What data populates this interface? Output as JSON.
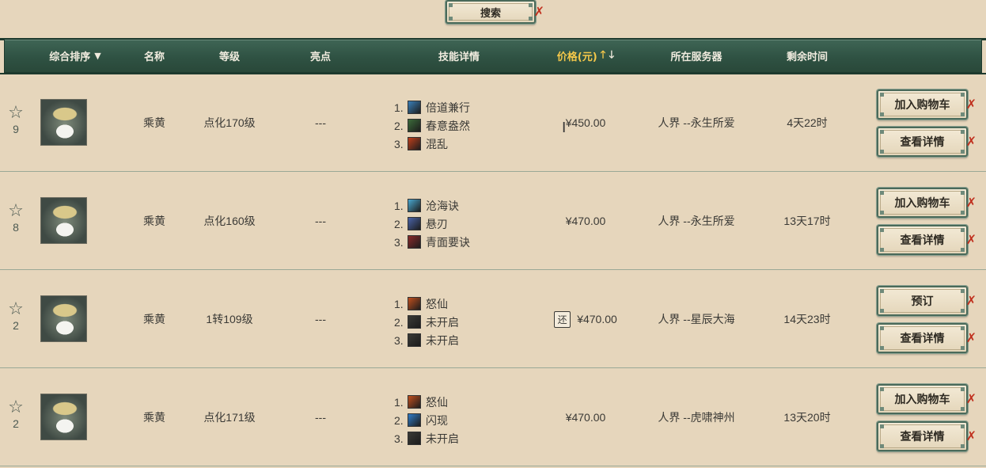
{
  "search": {
    "label": "搜索"
  },
  "header": {
    "sort": "综合排序",
    "name": "名称",
    "level": "等级",
    "highlight": "亮点",
    "skills": "技能详情",
    "price": "价格(元)",
    "server": "所在服务器",
    "time": "剩余时间"
  },
  "rows": [
    {
      "fav_count": "9",
      "name": "乘黄",
      "level": "点化170级",
      "highlight": "---",
      "skills": [
        {
          "num": "1.",
          "name": "倍道兼行",
          "color": "#3a7fb8"
        },
        {
          "num": "2.",
          "name": "春意盎然",
          "color": "#3c6b3a"
        },
        {
          "num": "3.",
          "name": "混乱",
          "color": "#c0401c"
        }
      ],
      "price": "¥450.00",
      "returnable": false,
      "server": "人界 --永生所爱",
      "time": "4天22时",
      "primary_button": "加入购物车",
      "detail_button": "查看详情"
    },
    {
      "fav_count": "8",
      "name": "乘黄",
      "level": "点化160级",
      "highlight": "---",
      "skills": [
        {
          "num": "1.",
          "name": "沧海诀",
          "color": "#4aa8d0"
        },
        {
          "num": "2.",
          "name": "悬刃",
          "color": "#4a64a8"
        },
        {
          "num": "3.",
          "name": "青面要诀",
          "color": "#8a2a2a"
        }
      ],
      "price": "¥470.00",
      "returnable": false,
      "server": "人界 --永生所爱",
      "time": "13天17时",
      "primary_button": "加入购物车",
      "detail_button": "查看详情"
    },
    {
      "fav_count": "2",
      "name": "乘黄",
      "level": "1转109级",
      "highlight": "---",
      "skills": [
        {
          "num": "1.",
          "name": "怒仙",
          "color": "#c2501e"
        },
        {
          "num": "2.",
          "name": "未开启",
          "color": "#3a3a36"
        },
        {
          "num": "3.",
          "name": "未开启",
          "color": "#3a3a36"
        }
      ],
      "price": "¥470.00",
      "returnable": true,
      "return_label": "还",
      "server": "人界 --星辰大海",
      "time": "14天23时",
      "primary_button": "预订",
      "detail_button": "查看详情"
    },
    {
      "fav_count": "2",
      "name": "乘黄",
      "level": "点化171级",
      "highlight": "---",
      "skills": [
        {
          "num": "1.",
          "name": "怒仙",
          "color": "#c2501e"
        },
        {
          "num": "2.",
          "name": "闪现",
          "color": "#2f7cc8"
        },
        {
          "num": "3.",
          "name": "未开启",
          "color": "#3a3a36"
        }
      ],
      "price": "¥470.00",
      "returnable": false,
      "server": "人界 --虎啸神州",
      "time": "13天20时",
      "primary_button": "加入购物车",
      "detail_button": "查看详情"
    }
  ]
}
